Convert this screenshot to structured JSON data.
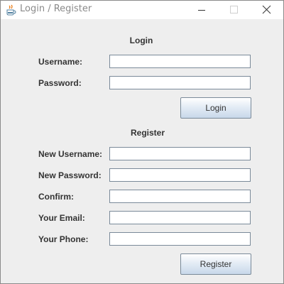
{
  "window": {
    "title": "Login / Register"
  },
  "login": {
    "heading": "Login",
    "username_label": "Username:",
    "username_value": "",
    "password_label": "Password:",
    "password_value": "",
    "button_label": "Login"
  },
  "register": {
    "heading": "Register",
    "new_username_label": "New Username:",
    "new_username_value": "",
    "new_password_label": "New Password:",
    "new_password_value": "",
    "confirm_label": "Confirm:",
    "confirm_value": "",
    "email_label": "Your Email:",
    "email_value": "",
    "phone_label": "Your Phone:",
    "phone_value": "",
    "button_label": "Register"
  },
  "icons": {
    "app": "java-coffee-icon",
    "minimize": "minimize-icon",
    "maximize": "maximize-icon",
    "close": "close-icon"
  }
}
